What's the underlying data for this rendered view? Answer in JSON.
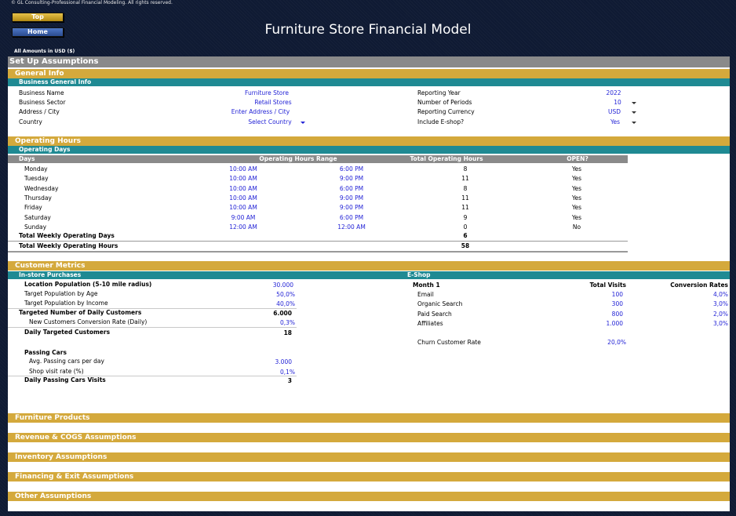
{
  "copyright": "© GL Consulting-Professional Financial Modeling. All rights reserved.",
  "nav": {
    "top": "Top",
    "home": "Home"
  },
  "title": "Furniture Store Financial Model",
  "amounts": "All Amounts in  USD ($)",
  "setup": "Set Up Assumptions",
  "general": {
    "section": "General Info",
    "sub": "Business General Info",
    "business_name": {
      "label": "Business Name",
      "value": "Furniture Store"
    },
    "business_sector": {
      "label": "Business Sector",
      "value": "Retail Stores"
    },
    "address": {
      "label": "Address / City",
      "value": "Enter Address / City"
    },
    "country": {
      "label": "Country",
      "value": "Select Country"
    },
    "reporting_year": {
      "label": "Reporting Year",
      "value": "2022"
    },
    "periods": {
      "label": "Number of Periods",
      "value": "10"
    },
    "currency": {
      "label": "Reporting Currency",
      "value": "USD"
    },
    "eshop": {
      "label": "Include E-shop?",
      "value": "Yes"
    }
  },
  "hours": {
    "section": "Operating Hours",
    "sub": "Operating Days",
    "headers": {
      "days": "Days",
      "range": "Operating Hours Range",
      "total": "Total Operating Hours",
      "open": "OPEN?"
    },
    "rows": [
      {
        "day": "Monday",
        "from": "10:00 AM",
        "to": "6:00 PM",
        "total": "8",
        "open": "Yes"
      },
      {
        "day": "Tuesday",
        "from": "10:00 AM",
        "to": "9:00 PM",
        "total": "11",
        "open": "Yes"
      },
      {
        "day": "Wednesday",
        "from": "10:00 AM",
        "to": "6:00 PM",
        "total": "8",
        "open": "Yes"
      },
      {
        "day": "Thursday",
        "from": "10:00 AM",
        "to": "9:00 PM",
        "total": "11",
        "open": "Yes"
      },
      {
        "day": "Friday",
        "from": "10:00 AM",
        "to": "9:00 PM",
        "total": "11",
        "open": "Yes"
      },
      {
        "day": "Saturday",
        "from": "9:00 AM",
        "to": "6:00 PM",
        "total": "9",
        "open": "Yes"
      },
      {
        "day": "Sunday",
        "from": "12:00 AM",
        "to": "12:00 AM",
        "total": "0",
        "open": "No"
      }
    ],
    "weekly_days": {
      "label": "Total Weekly Operating Days",
      "value": "6"
    },
    "weekly_hours": {
      "label": "Total Weekly Operating Hours",
      "value": "58"
    }
  },
  "customers": {
    "section": "Customer Metrics",
    "instore": "In-store Purchases",
    "location_pop": {
      "label": "Location Population (5-10 mile radius)",
      "value": "30.000"
    },
    "pop_age": {
      "label": "Target Population by Age",
      "value": "50,0%"
    },
    "pop_income": {
      "label": "Target Population by Income",
      "value": "40,0%"
    },
    "targeted_daily": {
      "label": "Targeted Number of Daily Customers",
      "value": "6.000"
    },
    "conversion": {
      "label": "New Customers Conversion Rate (Daily)",
      "value": "0,3%"
    },
    "daily_targeted": {
      "label": "Daily Targeted Customers",
      "value": "18"
    },
    "passing_cars": "Passing Cars",
    "avg_cars": {
      "label": "Avg. Passing cars per day",
      "value": "3.000"
    },
    "visit_rate": {
      "label": "Shop visit rate (%)",
      "value": "0,1%"
    },
    "daily_cars": {
      "label": "Daily Passing Cars Visits",
      "value": "3"
    },
    "eshop": "E-Shop",
    "eshop_headers": {
      "month": "Month 1",
      "visits": "Total Visits",
      "conv": "Conversion Rates"
    },
    "eshop_rows": [
      {
        "name": "Email",
        "visits": "100",
        "rate": "4,0%"
      },
      {
        "name": "Organic Search",
        "visits": "300",
        "rate": "3,0%"
      },
      {
        "name": "Paid Search",
        "visits": "800",
        "rate": "2,0%"
      },
      {
        "name": "Affiliates",
        "visits": "1.000",
        "rate": "3,0%"
      }
    ],
    "churn": {
      "label": "Churn Customer Rate",
      "value": "20,0%"
    }
  },
  "collapsed": [
    "Furniture Products",
    "Revenue & COGS Assumptions",
    "Inventory Assumptions",
    "Financing & Exit Assumptions",
    "Other Assumptions"
  ],
  "colors": {
    "gold": "#d4a93c",
    "teal": "#1f8a93",
    "grey": "#8a8a8a",
    "navy": "#0f1a33",
    "value": "#2323d6"
  }
}
